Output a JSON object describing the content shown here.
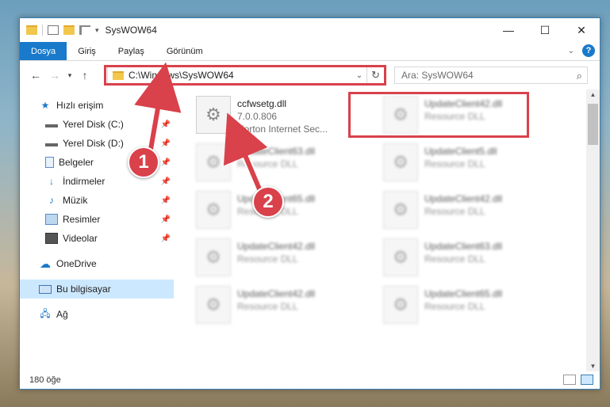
{
  "window": {
    "title": "SysWOW64",
    "controls": {
      "minimize": "—",
      "maximize": "☐",
      "close": "✕"
    }
  },
  "ribbon": {
    "tabs": [
      "Dosya",
      "Giriş",
      "Paylaş",
      "Görünüm"
    ],
    "help": "?"
  },
  "address": {
    "path": "C:\\Windows\\SysWOW64",
    "search_placeholder": "Ara: SysWOW64"
  },
  "sidebar": {
    "quick_access": "Hızlı erişim",
    "items": [
      {
        "label": "Yerel Disk (C:)",
        "icon": "drive-icon"
      },
      {
        "label": "Yerel Disk (D:)",
        "icon": "drive-icon"
      },
      {
        "label": "Belgeler",
        "icon": "documents-icon"
      },
      {
        "label": "İndirmeler",
        "icon": "download-icon"
      },
      {
        "label": "Müzik",
        "icon": "music-icon"
      },
      {
        "label": "Resimler",
        "icon": "pictures-icon"
      },
      {
        "label": "Videolar",
        "icon": "videos-icon"
      }
    ],
    "onedrive": "OneDrive",
    "this_pc": "Bu bilgisayar",
    "network": "Ağ"
  },
  "files": {
    "highlighted": {
      "name": "ccfwsetg.dll",
      "version": "7.0.0.806",
      "description": "Norton Internet Sec..."
    },
    "tiles": [
      {
        "name": "UpdateClient42.dll",
        "sub": "Resource DLL"
      },
      {
        "name": "UpdateClient63.dll",
        "sub": "Resource DLL"
      },
      {
        "name": "UpdateClient5.dll",
        "sub": "Resource DLL"
      },
      {
        "name": "UpdateClient65.dll",
        "sub": "Resource DLL"
      },
      {
        "name": "UpdateClient42.dll",
        "sub": "Resource DLL"
      },
      {
        "name": "UpdateClient42.dll",
        "sub": "Resource DLL"
      },
      {
        "name": "UpdateClient63.dll",
        "sub": "Resource DLL"
      },
      {
        "name": "UpdateClient42.dll",
        "sub": "Resource DLL"
      },
      {
        "name": "UpdateClient65.dll",
        "sub": "Resource DLL"
      }
    ]
  },
  "status": {
    "count": "180 öğe"
  },
  "annotations": {
    "step1": "1",
    "step2": "2",
    "color": "#d9414b"
  }
}
